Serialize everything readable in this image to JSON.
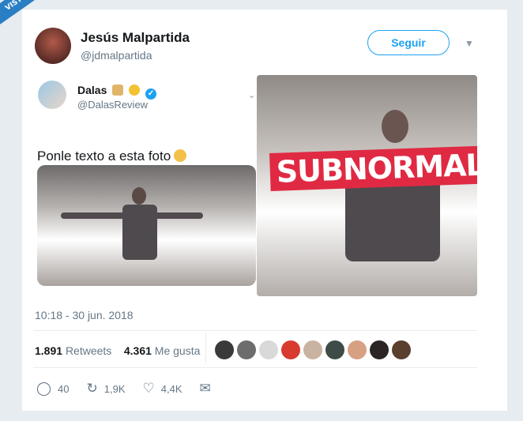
{
  "watermark": "VISTOENLASREDES",
  "author": {
    "name": "Jesús Malpartida",
    "handle": "@jdmalpartida",
    "follow_label": "Seguir"
  },
  "quoted": {
    "name": "Dalas",
    "handle": "@DalasReview",
    "text": "Ponle texto a esta foto"
  },
  "image_caption": "SUBNORMAL",
  "timestamp": "10:18 - 30 jun. 2018",
  "stats": {
    "retweets_count": "1.891",
    "retweets_label": "Retweets",
    "likes_count": "4.361",
    "likes_label": "Me gusta"
  },
  "actions": {
    "replies": "40",
    "retweets": "1,9K",
    "likes": "4,4K"
  },
  "icons": [
    "chevron-down-icon",
    "verified-icon",
    "reply-icon",
    "retweet-icon",
    "heart-icon",
    "mail-icon"
  ],
  "colors": {
    "accent": "#1da1f2",
    "caption_bg": "#e02a43",
    "watermark_bg": "#2a7fc4"
  }
}
